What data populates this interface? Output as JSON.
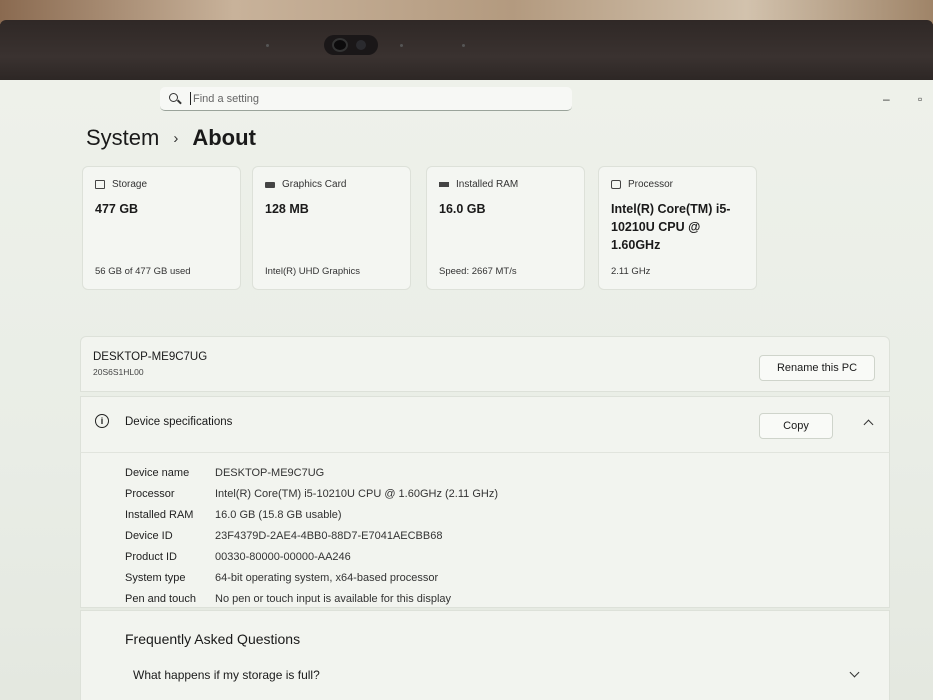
{
  "search": {
    "placeholder": "Find a setting"
  },
  "breadcrumb": {
    "parent": "System",
    "separator": "›",
    "current": "About"
  },
  "cards": [
    {
      "label": "Storage",
      "value": "477 GB",
      "detail": "56 GB of 477 GB used",
      "icon": "storage-icon"
    },
    {
      "label": "Graphics Card",
      "value": "128 MB",
      "detail": "Intel(R) UHD Graphics",
      "icon": "graphics-card-icon"
    },
    {
      "label": "Installed RAM",
      "value": "16.0 GB",
      "detail": "Speed: 2667 MT/s",
      "icon": "ram-icon"
    },
    {
      "label": "Processor",
      "value": "Intel(R) Core(TM) i5-10210U CPU @ 1.60GHz",
      "detail": "2.11 GHz",
      "icon": "processor-icon"
    }
  ],
  "pc": {
    "name": "DESKTOP-ME9C7UG",
    "model": "20S6S1HL00",
    "rename_label": "Rename this PC"
  },
  "specs": {
    "title": "Device specifications",
    "copy_label": "Copy",
    "rows": [
      {
        "key": "Device name",
        "value": "DESKTOP-ME9C7UG"
      },
      {
        "key": "Processor",
        "value": "Intel(R) Core(TM) i5-10210U CPU @ 1.60GHz (2.11 GHz)"
      },
      {
        "key": "Installed RAM",
        "value": "16.0 GB (15.8 GB usable)"
      },
      {
        "key": "Device ID",
        "value": "23F4379D-2AE4-4BB0-88D7-E7041AECBB68"
      },
      {
        "key": "Product ID",
        "value": "00330-80000-00000-AA246"
      },
      {
        "key": "System type",
        "value": "64-bit operating system, x64-based processor"
      },
      {
        "key": "Pen and touch",
        "value": "No pen or touch input is available for this display"
      }
    ]
  },
  "faq": {
    "title": "Frequently Asked Questions",
    "question": "What happens if my storage is full?"
  },
  "window": {
    "minimize": "–",
    "restore": "▫"
  }
}
